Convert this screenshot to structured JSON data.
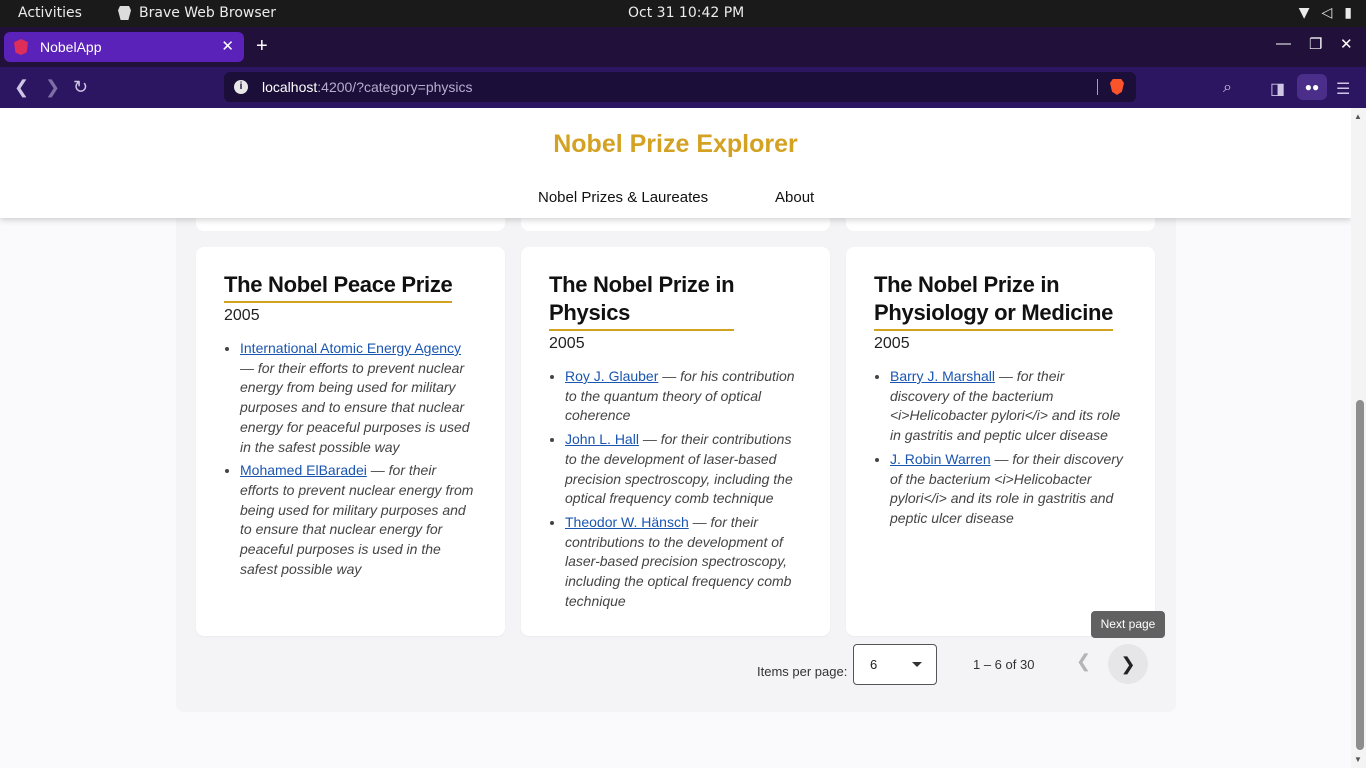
{
  "system_bar": {
    "activities": "Activities",
    "app_name": "Brave Web Browser",
    "clock": "Oct 31  10:42 PM"
  },
  "browser": {
    "tab_title": "NobelApp",
    "url_host": "localhost",
    "url_rest": ":4200/?category=physics"
  },
  "header": {
    "title": "Nobel Prize Explorer",
    "nav": [
      "Nobel Prizes & Laureates",
      "About"
    ]
  },
  "cards": [
    {
      "title_lines": [
        "The Nobel Peace Prize"
      ],
      "year": "2005",
      "laureates": [
        {
          "name": "International Atomic Energy Agency",
          "motivation": " — for their efforts to prevent nuclear energy from being used for military purposes and to ensure that nuclear energy for peaceful purposes is used in the safest possible way"
        },
        {
          "name": "Mohamed ElBaradei",
          "motivation": " — for their efforts to prevent nuclear energy from being used for military purposes and to ensure that nuclear energy for peaceful purposes is used in the safest possible way"
        }
      ]
    },
    {
      "title_lines": [
        "The Nobel Prize in",
        "Physics"
      ],
      "year": "2005",
      "laureates": [
        {
          "name": "Roy J. Glauber",
          "motivation": " — for his contribution to the quantum theory of optical coherence"
        },
        {
          "name": "John L. Hall",
          "motivation": " — for their contributions to the development of laser-based precision spectroscopy, including the optical frequency comb technique"
        },
        {
          "name": "Theodor W. Hänsch",
          "motivation": " — for their contributions to the development of laser-based precision spectroscopy, including the optical frequency comb technique"
        }
      ]
    },
    {
      "title_lines": [
        "The Nobel Prize in",
        "Physiology or Medicine"
      ],
      "year": "2005",
      "laureates": [
        {
          "name": "Barry J. Marshall",
          "motivation": " — for their discovery of the bacterium <i>Helicobacter pylori</i> and its role in gastritis and peptic ulcer disease"
        },
        {
          "name": "J. Robin Warren",
          "motivation": " — for their discovery of the bacterium <i>Helicobacter pylori</i> and its role in gastritis and peptic ulcer disease"
        }
      ]
    }
  ],
  "paginator": {
    "items_per_page_label": "Items per page:",
    "items_per_page_value": "6",
    "range_label": "1 – 6 of 30",
    "next_tooltip": "Next page"
  }
}
